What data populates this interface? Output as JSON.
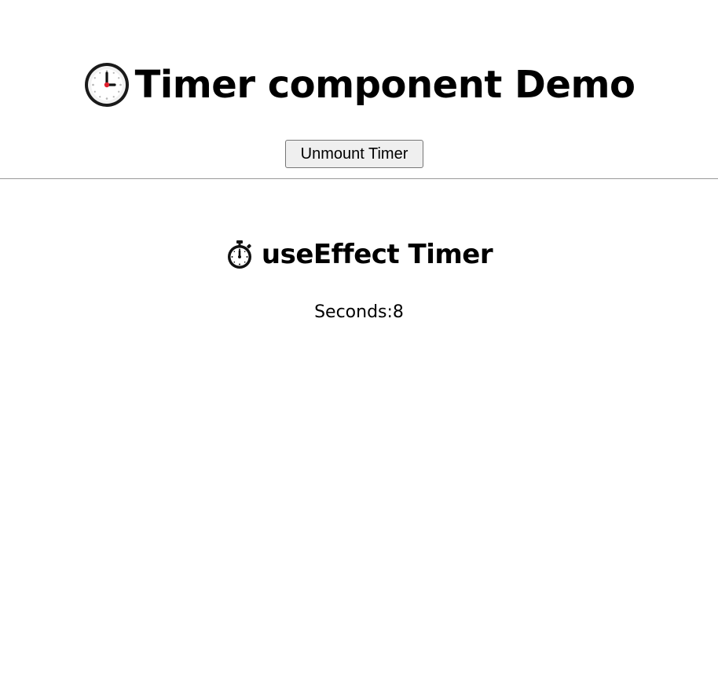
{
  "header": {
    "icon": "clock-icon",
    "title": "Timer component Demo"
  },
  "controls": {
    "unmount_label": "Unmount Timer"
  },
  "timer": {
    "icon": "stopwatch-icon",
    "title": "useEffect Timer",
    "seconds_label": "Seconds:",
    "seconds_value": "8"
  }
}
